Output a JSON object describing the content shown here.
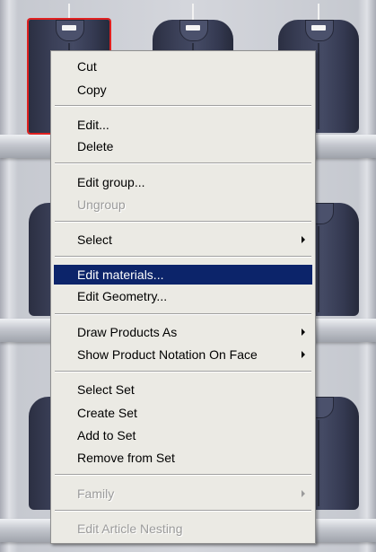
{
  "menu": {
    "cut": "Cut",
    "copy": "Copy",
    "edit": "Edit...",
    "delete": "Delete",
    "edit_group": "Edit group...",
    "ungroup": "Ungroup",
    "select": "Select",
    "edit_materials": "Edit materials...",
    "edit_geometry": "Edit Geometry...",
    "draw_products_as": "Draw Products As",
    "show_product_notation": "Show Product Notation On Face",
    "select_set": "Select Set",
    "create_set": "Create Set",
    "add_to_set": "Add to Set",
    "remove_from_set": "Remove from Set",
    "family": "Family",
    "edit_article_nesting": "Edit Article Nesting"
  },
  "colors": {
    "menu_background": "#ebeae4",
    "highlight": "#0c246a",
    "disabled_text": "#9b9b9b",
    "selection_outline": "#e02020"
  },
  "icons": {
    "submenu": "submenu-arrow-icon"
  }
}
